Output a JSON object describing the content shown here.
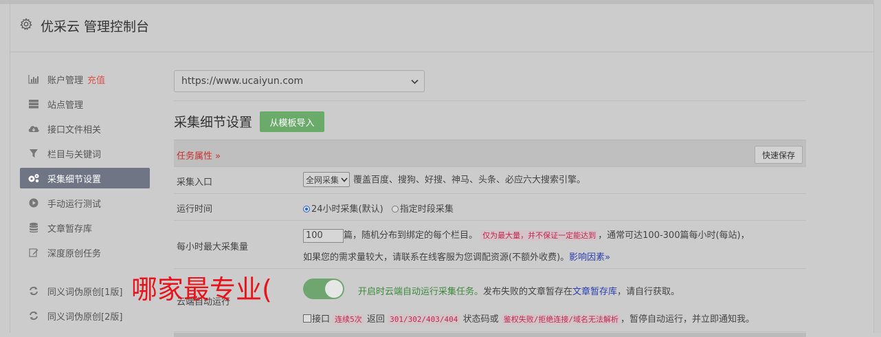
{
  "header": {
    "title": "优采云 管理控制台",
    "icon": "gear-icon"
  },
  "sidebar": {
    "items": [
      {
        "label": "账户管理",
        "extra": "充值",
        "icon": "bar-chart-icon",
        "active": false
      },
      {
        "label": "站点管理",
        "icon": "server-icon",
        "active": false
      },
      {
        "label": "接口文件相关",
        "icon": "cloud-download-icon",
        "active": false
      },
      {
        "label": "栏目与关键词",
        "icon": "filter-icon",
        "active": false
      },
      {
        "label": "采集细节设置",
        "icon": "gears-icon",
        "active": true
      },
      {
        "label": "手动运行测试",
        "icon": "play-circle-icon",
        "active": false
      },
      {
        "label": "文章暂存库",
        "icon": "database-icon",
        "active": false
      },
      {
        "label": "深度原创任务",
        "icon": "edit-icon",
        "active": false
      },
      {
        "label": "同义词伪原创[1版]",
        "icon": "refresh-icon",
        "active": false
      },
      {
        "label": "同义词伪原创[2版]",
        "icon": "refresh-icon",
        "active": false
      }
    ]
  },
  "site_select": {
    "value": "https://www.ucaiyun.com"
  },
  "section": {
    "title": "采集细节设置",
    "import_button": "从模板导入"
  },
  "table": {
    "header_label": "任务属性 »",
    "quick_save": "快速保存",
    "row1": {
      "label": "采集入口",
      "select": "全网采集",
      "desc": "覆盖百度、搜狗、好搜、神马、头条、必应六大搜索引擎。"
    },
    "row2": {
      "label": "运行时间",
      "opt1": "24小时采集(默认)",
      "opt2": "指定时段采集"
    },
    "row3": {
      "label": "每小时最大采集量",
      "value": "100",
      "text1": "篇，随机分布到绑定的每个栏目。",
      "code1": "仅为最大量，并不保证一定能达到",
      "text2": "，通常可达100-300篇每小时(每站)，",
      "line2": "如果您的需求量较大，请联系在线客服为您调配资源(不额外收费)。",
      "link": "影响因素»"
    },
    "row4": {
      "label": "云端自动运行",
      "green_text": "开启时云端自动运行采集任务。",
      "text1": "发布失败的文章暂存在",
      "link": "文章暂存库",
      "text2": "，请自行获取。",
      "chk_label": "接口",
      "code1": "连续5次",
      "text3": "返回",
      "code2": "301/302/403/404",
      "text4": "状态码或",
      "code3": "鉴权失败/拒绝连接/域名无法解析",
      "text5": "，暂停自动运行，并立即通知我。"
    }
  },
  "overlay_text": "哪家最专业("
}
